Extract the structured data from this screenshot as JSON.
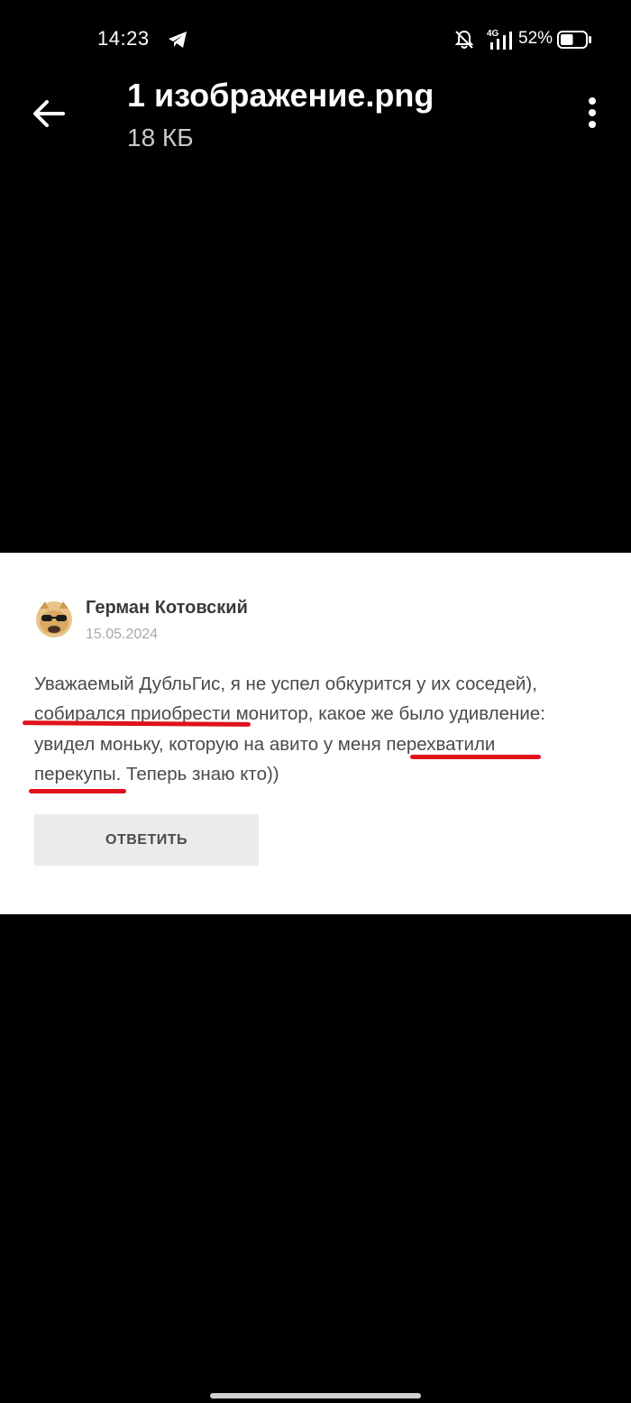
{
  "status_bar": {
    "time": "14:23",
    "network_type": "4G",
    "battery_percent": "52%",
    "battery_level": 0.52,
    "icons": [
      "telegram-icon",
      "bell-off-icon",
      "signal-icon",
      "battery-icon"
    ]
  },
  "app_bar": {
    "back_icon": "arrow-left-icon",
    "title": "1 изображение.png",
    "subtitle": "18 КБ",
    "menu_icon": "more-vertical-icon"
  },
  "review": {
    "author": "Герман Котовский",
    "date": "15.05.2024",
    "lines": [
      "Уважаемый ДубльГис, я не успел обкурится у их соседей),",
      "собирался приобрести монитор, какое же было удивление:",
      "увидел моньку, которую на авито у меня перехватили",
      "перекупы. Теперь знаю кто))"
    ],
    "underlined_phrases": [
      "собирался приобрести",
      "перехватили",
      "перекупы"
    ],
    "reply_label": "ОТВЕТИТЬ",
    "highlight_color": "#e0121b"
  }
}
